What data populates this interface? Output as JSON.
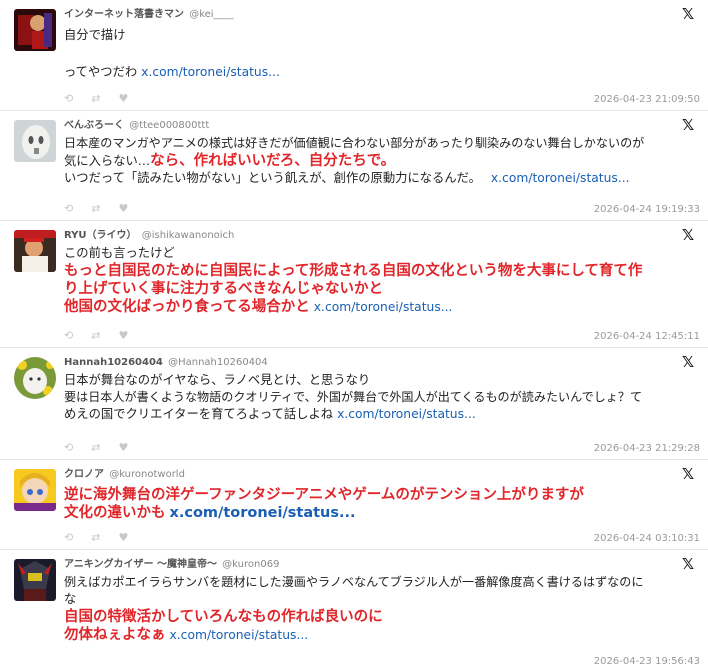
{
  "posts": [
    {
      "name": "インターネット落書きマン",
      "handle": "@kei____",
      "lines": [
        {
          "text": "自分で描け",
          "style": "normal"
        },
        {
          "text": "",
          "style": "spacer"
        },
        {
          "text": "ってやつだわ",
          "style": "normal",
          "link": "x.com/toronei/status..."
        }
      ],
      "timestamp": "2026-04-23 21:09:50",
      "avatar": "dark-red-figure"
    },
    {
      "name": "べんぶろーく",
      "handle": "@ttee000800ttt",
      "lines": [
        {
          "text": "日本産のマンガやアニメの様式は好きだが価値観に合わない部分があったり馴染みのない舞台しかないのが",
          "style": "normal"
        },
        {
          "text": "気に入らない…",
          "style": "normal",
          "red": "なら、作ればいいだろ、自分たちで。"
        },
        {
          "text": "いつだって「読みたい物がない」という飢えが、創作の原動力になるんだ。",
          "style": "normal",
          "link": "x.com/toronei/status..."
        }
      ],
      "timestamp": "2026-04-24 19:19:33",
      "avatar": "white-mask"
    },
    {
      "name": "RYU（ライウ）",
      "handle": "@ishikawanonoich",
      "lines": [
        {
          "text": "この前も言ったけど",
          "style": "normal"
        },
        {
          "text": "もっと自国民のために自国民によって形成される自国の文化という物を大事にして育て作",
          "style": "red"
        },
        {
          "text": "り上げていく事に注力するべきなんじゃないかと",
          "style": "red"
        },
        {
          "text": "他国の文化ばっかり食ってる場合かと",
          "style": "red",
          "link": "x.com/toronei/status..."
        }
      ],
      "timestamp": "2026-04-24 12:45:11",
      "avatar": "fighter"
    },
    {
      "name": "Hannah10260404",
      "handle": "@Hannah10260404",
      "lines": [
        {
          "text": "日本が舞台なのがイヤなら、ラノベ見とけ、と思うなり",
          "style": "normal"
        },
        {
          "text": "要は日本人が書くような物語のクオリティで、外国が舞台で外国人が出てくるものが読みたいんでしょ？て",
          "style": "normal"
        },
        {
          "text": "めえの国でクリエイターを育てろよって話しよね",
          "style": "normal",
          "link": "x.com/toronei/status..."
        }
      ],
      "timestamp": "2026-04-23 21:29:28",
      "avatar": "cat-flowers"
    },
    {
      "name": "クロノア",
      "handle": "@kuronotworld",
      "lines": [
        {
          "text": "逆に海外舞台の洋ゲーファンタジーアニメやゲームのがテンション上がりますが",
          "style": "red"
        },
        {
          "text": "文化の違いかも",
          "style": "red",
          "boldlink": "x.com/toronei/status..."
        }
      ],
      "timestamp": "2026-04-24 03:10:31",
      "avatar": "blonde-character"
    },
    {
      "name": "アニキングカイザー 〜魔神皇帝〜",
      "handle": "@kuron069",
      "lines": [
        {
          "text": "例えばカポエイラらサンバを題材にした漫画やラノベなんてブラジル人が一番解像度高く書けるはずなのに",
          "style": "normal"
        },
        {
          "text": "な",
          "style": "normal"
        },
        {
          "text": "自国の特徴活かしていろんなもの作れば良いのに",
          "style": "red"
        },
        {
          "text": "勿体ねぇよなぁ",
          "style": "red",
          "link": "x.com/toronei/status..."
        }
      ],
      "timestamp": "2026-04-23 19:56:43",
      "avatar": "robot"
    }
  ],
  "icons": {
    "platform": "x-logo-icon",
    "reply": "reply-icon",
    "repost": "repost-icon",
    "like": "heart-icon"
  },
  "colors": {
    "emphasis": "#e0262a",
    "link": "#1a5fb4",
    "timestamp": "#9a9a9a"
  }
}
